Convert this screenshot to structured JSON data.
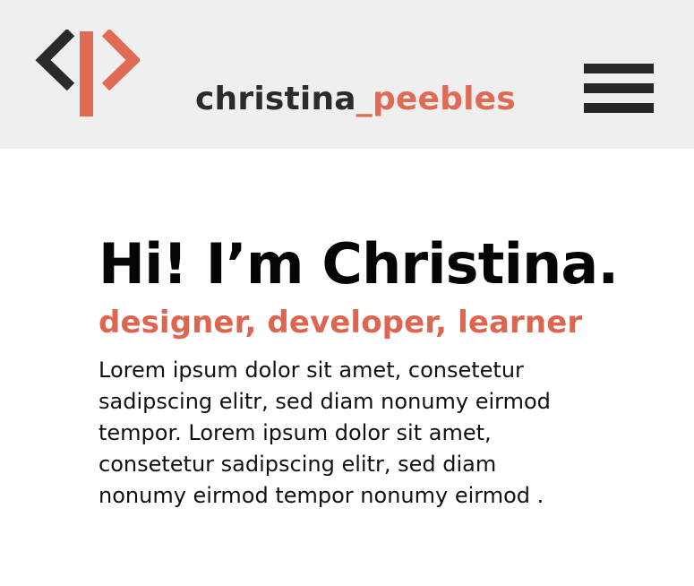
{
  "header": {
    "logo": {
      "icon": "code-brackets-logo-icon",
      "colors": {
        "bracket": "#2a2a2a",
        "accent": "#df6b55"
      }
    },
    "brand": {
      "first": "christina",
      "last": "_peebles"
    },
    "menu": {
      "icon": "hamburger-menu-icon"
    }
  },
  "hero": {
    "title": "Hi! I’m Christina.",
    "subtitle": "designer, developer, learner",
    "body": "Lorem ipsum dolor sit amet, consetetur sadipscing elitr, sed diam nonumy eirmod tempor. Lorem ipsum dolor sit amet, consetetur sadipscing elitr, sed diam nonumy eirmod tempor nonumy eirmod ."
  },
  "colors": {
    "header_bg": "#efefef",
    "accent": "#df6b55",
    "text": "#111111"
  }
}
